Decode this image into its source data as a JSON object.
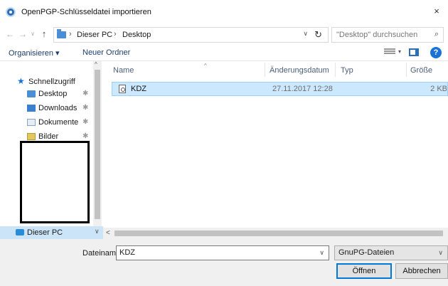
{
  "window": {
    "title": "OpenPGP-Schlüsseldatei importieren",
    "close_glyph": "×",
    "icon": "app-icon"
  },
  "navigation": {
    "back_glyph": "←",
    "forward_glyph": "→",
    "recent_glyph": "∨",
    "up_glyph": "↑",
    "address": {
      "crumbs": [
        "Dieser PC",
        "Desktop"
      ],
      "separator": "›",
      "dropdown_glyph": "∨",
      "refresh_glyph": "↻"
    },
    "search": {
      "placeholder": "\"Desktop\" durchsuchen",
      "icon_glyph": "⌕"
    }
  },
  "commandbar": {
    "organize_label": "Organisieren ▾",
    "new_folder_label": "Neuer Ordner",
    "view_dd_glyph": "▾",
    "help_glyph": "?"
  },
  "sidebar": {
    "quick_access": "Schnellzugriff",
    "items": [
      {
        "label": "Desktop",
        "icon": "desktop-folder-icon"
      },
      {
        "label": "Downloads",
        "icon": "downloads-folder-icon"
      },
      {
        "label": "Dokumente",
        "icon": "documents-folder-icon"
      },
      {
        "label": "Bilder",
        "icon": "pictures-folder-icon"
      }
    ],
    "pin_glyph": "✱",
    "this_pc": "Dieser PC",
    "scroll_up_glyph": "^",
    "scroll_down_glyph": "∨"
  },
  "file_list": {
    "columns": [
      "Name",
      "Änderungsdatum",
      "Typ",
      "Größe"
    ],
    "sort_glyph": "^",
    "rows": [
      {
        "name": "KDZ",
        "date": "27.11.2017 12:28",
        "type": "",
        "size": "2 KB"
      }
    ],
    "hscroll_left_glyph": "<"
  },
  "footer": {
    "filename_label": "Dateiname:",
    "filename_value": "KDZ",
    "filename_dd_glyph": "∨",
    "filetype_value": "GnuPG-Dateien",
    "filetype_dd_glyph": "∨",
    "open_label": "Öffnen",
    "cancel_label": "Abbrechen"
  },
  "colors": {
    "accent": "#0078d7",
    "selection": "#cce8ff",
    "link": "#1e3d6b"
  }
}
